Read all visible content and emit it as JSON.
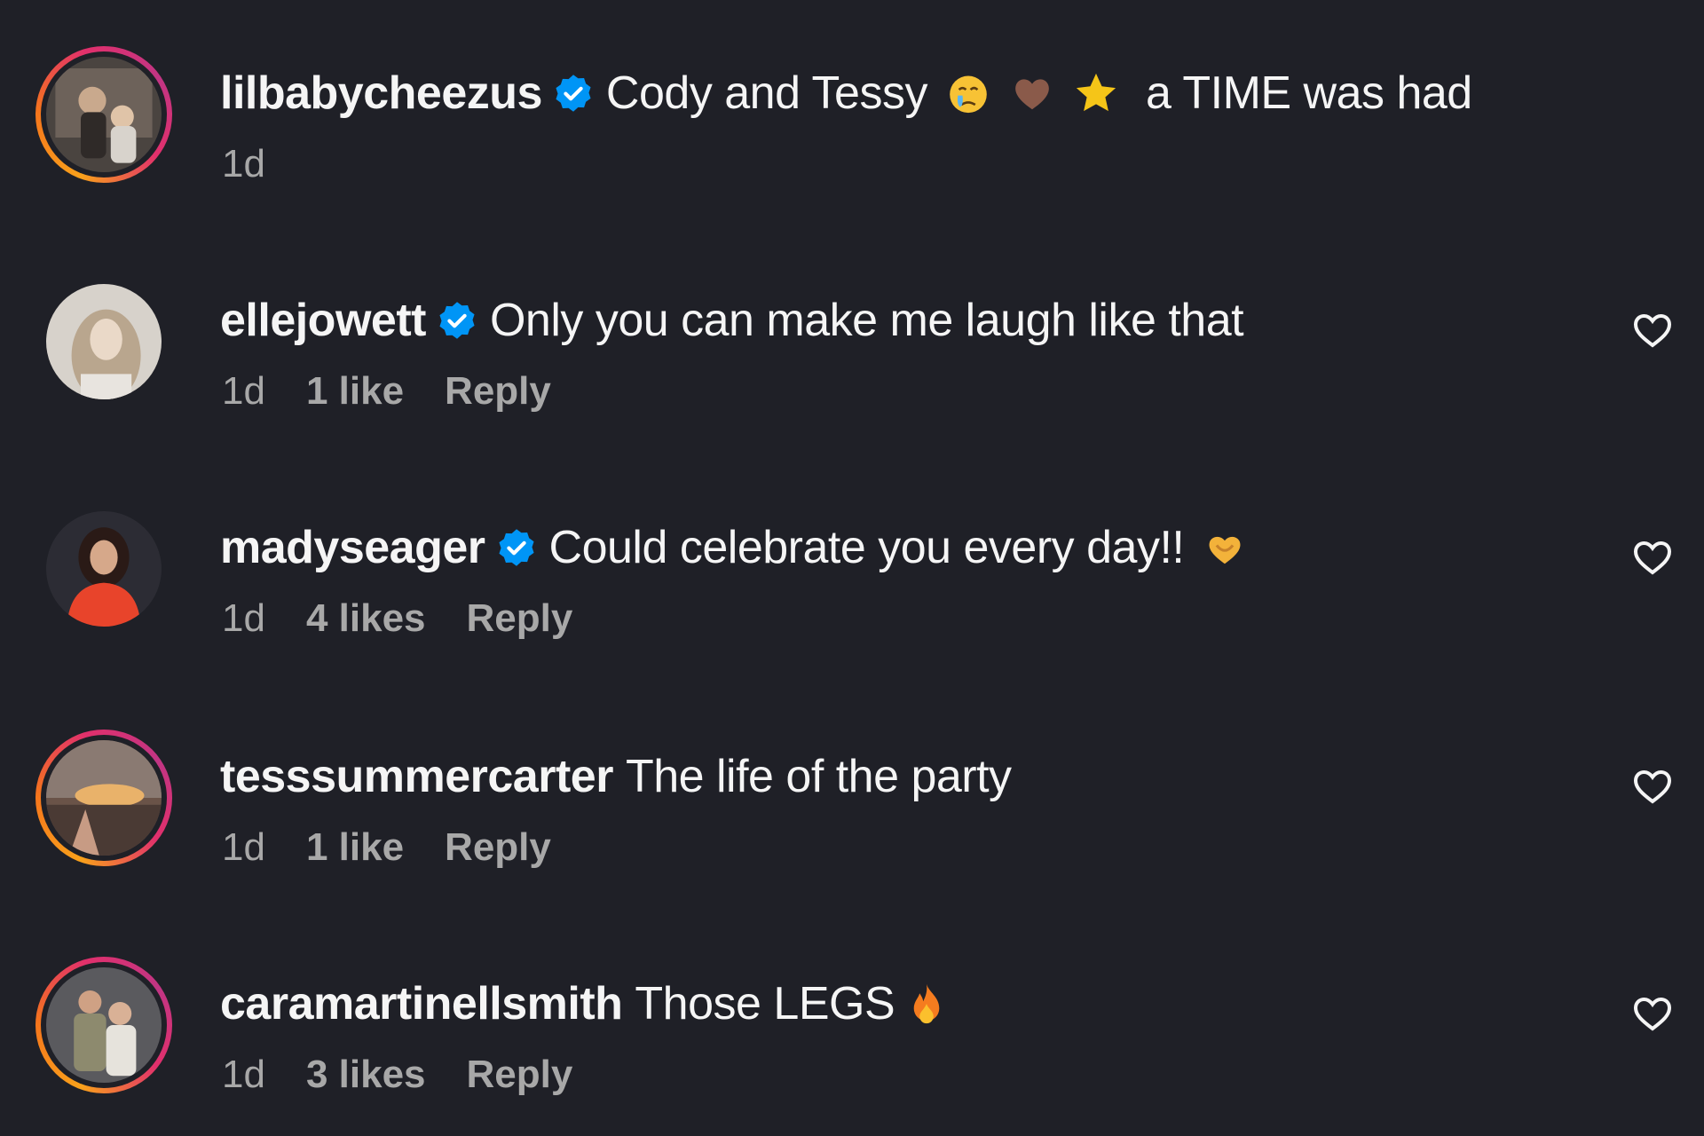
{
  "comments": [
    {
      "username": "lilbabycheezus",
      "verified": true,
      "text_before": "Cody and Tessy",
      "emojis": [
        "crying-face-emoji",
        "brown-heart-emoji",
        "star-emoji"
      ],
      "text_after": "a TIME was had",
      "time": "1d",
      "likes": "",
      "reply": "",
      "has_heart": false,
      "ring": true
    },
    {
      "username": "ellejowett",
      "verified": true,
      "text_before": "Only you can make me laugh like that",
      "emojis": [],
      "text_after": "",
      "time": "1d",
      "likes": "1 like",
      "reply": "Reply",
      "has_heart": true,
      "ring": false
    },
    {
      "username": "madyseager",
      "verified": true,
      "text_before": "Could celebrate you every day!!",
      "emojis": [
        "heart-hands-emoji"
      ],
      "text_after": "",
      "time": "1d",
      "likes": "4 likes",
      "reply": "Reply",
      "has_heart": true,
      "ring": false
    },
    {
      "username": "tesssummercarter",
      "verified": false,
      "text_before": "The life of the party",
      "emojis": [],
      "text_after": "",
      "time": "1d",
      "likes": "1 like",
      "reply": "Reply",
      "has_heart": true,
      "ring": true
    },
    {
      "username": "caramartinellsmith",
      "verified": false,
      "text_before": "Those LEGS",
      "emojis": [
        "fire-emoji"
      ],
      "text_after": "",
      "time": "1d",
      "likes": "3 likes",
      "reply": "Reply",
      "has_heart": true,
      "ring": true
    }
  ],
  "colors": {
    "background": "#1f2027",
    "text": "#f5f5f5",
    "secondary_text": "#a8a8a8",
    "verified_badge": "#0095f6"
  }
}
